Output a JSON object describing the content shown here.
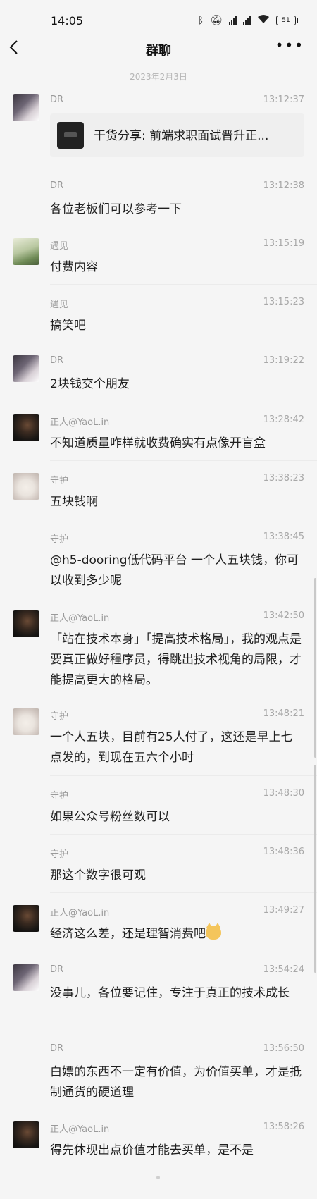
{
  "status_bar": {
    "time": "14:05",
    "battery": "51",
    "network_label": "HD"
  },
  "nav": {
    "title": "群聊"
  },
  "date_separator": "2023年2月3日",
  "messages": [
    {
      "sender": "DR",
      "time": "13:12:37",
      "type": "link",
      "text": "干货分享: 前端求职面试晋升正..."
    },
    {
      "sender": "DR",
      "time": "13:12:38",
      "text": "各位老板们可以参考一下"
    },
    {
      "sender": "遇见",
      "time": "13:15:19",
      "text": "付费内容"
    },
    {
      "sender": "遇见",
      "time": "13:15:23",
      "text": "搞笑吧"
    },
    {
      "sender": "DR",
      "time": "13:19:22",
      "text": "2块钱交个朋友"
    },
    {
      "sender": "正人@YaoL.in",
      "time": "13:28:42",
      "text": "不知道质量咋样就收费确实有点像开盲盒"
    },
    {
      "sender": "守护",
      "time": "13:38:23",
      "text": "五块钱啊"
    },
    {
      "sender": "守护",
      "time": "13:38:45",
      "text": "@h5-dooring低代码平台 一个人五块钱，你可以收到多少呢"
    },
    {
      "sender": "正人@YaoL.in",
      "time": "13:42:50",
      "text": "「站在技术本身」「提高技术格局」，我的观点是要真正做好程序员，得跳出技术视角的局限，才能提高更大的格局。"
    },
    {
      "sender": "守护",
      "time": "13:48:21",
      "text": "一个人五块，目前有25人付了，这还是早上七点发的，到现在五六个小时"
    },
    {
      "sender": "守护",
      "time": "13:48:30",
      "text": "如果公众号粉丝数可以"
    },
    {
      "sender": "守护",
      "time": "13:48:36",
      "text": "那这个数字很可观"
    },
    {
      "sender": "正人@YaoL.in",
      "time": "13:49:27",
      "text": "经济这么差，还是理智消费吧"
    },
    {
      "sender": "DR",
      "time": "13:54:24",
      "text": "没事儿，各位要记住，专注于真正的技术成长"
    },
    {
      "sender": "DR",
      "time": "13:56:50",
      "text": "白嫖的东西不一定有价值，为价值买单，才是抵制通货的硬道理"
    },
    {
      "sender": "正人@YaoL.in",
      "time": "13:58:26",
      "text": "得先体现出点价值才能去买单，是不是"
    }
  ]
}
